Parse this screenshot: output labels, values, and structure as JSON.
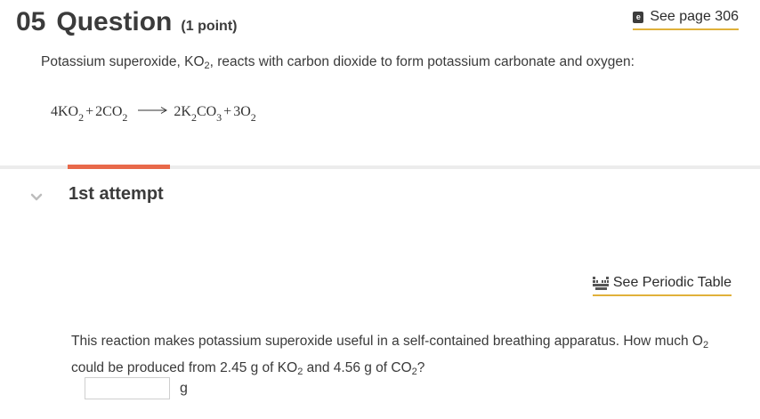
{
  "header": {
    "number": "05",
    "title": "Question",
    "points": "(1 point)",
    "see_page_icon": "ebook-icon",
    "see_page_icon_glyph": "e",
    "see_page_label": "See page 306"
  },
  "intro": {
    "pre": "Potassium superoxide, KO",
    "sub": "2",
    "post": ", reacts with carbon dioxide to form potassium carbonate and oxygen:"
  },
  "equation": {
    "r1_coef": "4KO",
    "r1_sub": "2",
    "plus1": "+",
    "r2_coef": "2CO",
    "r2_sub": "2",
    "arrow_icon": "right-arrow-icon",
    "p1_a": "2K",
    "p1_sub_a": "2",
    "p1_b": "CO",
    "p1_sub_b": "3",
    "plus2": "+",
    "p2_coef": "3O",
    "p2_sub": "2"
  },
  "colors": {
    "tab_indicator": "#e8694a",
    "link_underline": "#e0b13a",
    "divider": "#ececec"
  },
  "attempt": {
    "chevron_icon": "chevron-down-icon",
    "title": "1st attempt"
  },
  "periodic": {
    "icon": "periodic-table-icon",
    "label": "See Periodic Table"
  },
  "question": {
    "t1": "This reaction makes potassium superoxide useful in a self-contained breathing apparatus. How much O",
    "s1": "2",
    "t2": " could be produced from 2.45 g of KO",
    "s2": "2",
    "t3": " and 4.56 g of CO",
    "s3": "2",
    "t4": "?"
  },
  "answer": {
    "value": "",
    "unit": "g"
  }
}
